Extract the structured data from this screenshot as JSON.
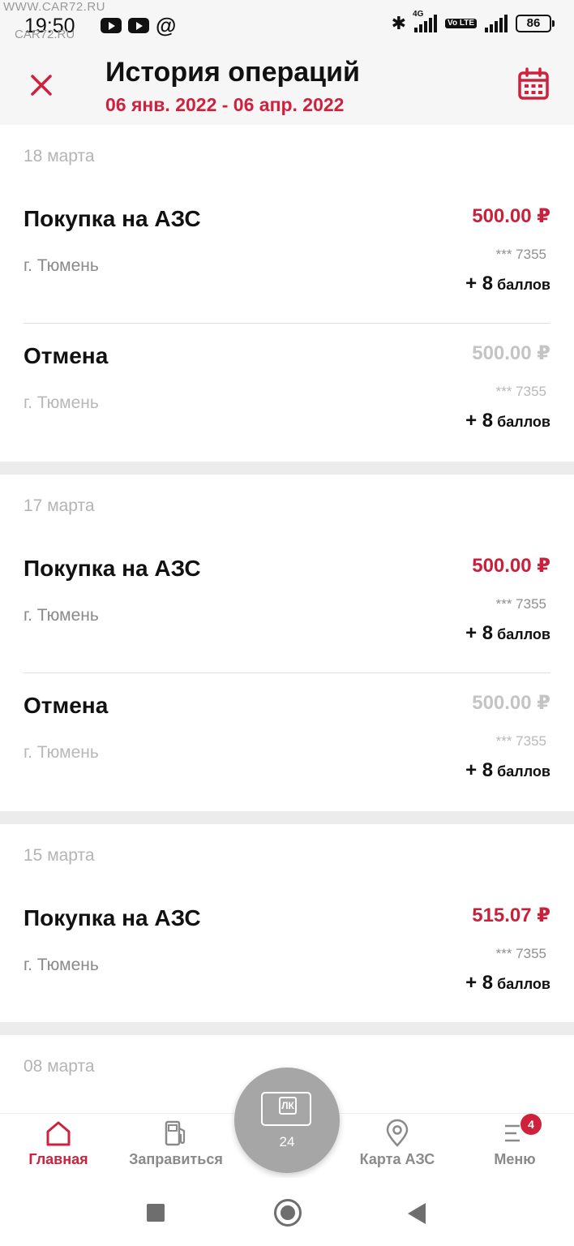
{
  "status_bar": {
    "time": "19:50",
    "watermark": "WWW.CAR72.RU",
    "watermark2": "CAR72.RU",
    "network_4g": "4G",
    "volte": "Vo LTE",
    "battery": "86"
  },
  "header": {
    "title": "История операций",
    "period": "06 янв. 2022 - 06 апр. 2022",
    "close_icon": "close-icon",
    "calendar_icon": "calendar-icon",
    "accent_color": "#d0213c"
  },
  "groups": [
    {
      "date": "18 марта",
      "operations": [
        {
          "title": "Покупка на АЗС",
          "city": "г. Тюмень",
          "amount": "500.00 ₽",
          "card": "*** 7355",
          "bonus_value": "+ 8",
          "bonus_unit": "баллов",
          "status": "purchase"
        },
        {
          "title": "Отмена",
          "city": "г. Тюмень",
          "amount": "500.00 ₽",
          "card": "*** 7355",
          "bonus_value": "+ 8",
          "bonus_unit": "баллов",
          "status": "cancel"
        }
      ]
    },
    {
      "date": "17 марта",
      "operations": [
        {
          "title": "Покупка на АЗС",
          "city": "г. Тюмень",
          "amount": "500.00 ₽",
          "card": "*** 7355",
          "bonus_value": "+ 8",
          "bonus_unit": "баллов",
          "status": "purchase"
        },
        {
          "title": "Отмена",
          "city": "г. Тюмень",
          "amount": "500.00 ₽",
          "card": "*** 7355",
          "bonus_value": "+ 8",
          "bonus_unit": "баллов",
          "status": "cancel"
        }
      ]
    },
    {
      "date": "15 марта",
      "operations": [
        {
          "title": "Покупка на АЗС",
          "city": "г. Тюмень",
          "amount": "515.07 ₽",
          "card": "*** 7355",
          "bonus_value": "+ 8",
          "bonus_unit": "баллов",
          "status": "purchase"
        }
      ]
    },
    {
      "date": "08 марта",
      "operations": []
    }
  ],
  "bottom_nav": {
    "items": [
      {
        "label": "Главная",
        "icon": "home-icon",
        "active": true
      },
      {
        "label": "Заправиться",
        "icon": "fuel-pump-icon",
        "active": false
      },
      {
        "label": "Карта АЗС",
        "icon": "map-pin-icon",
        "active": false
      },
      {
        "label": "Меню",
        "icon": "menu-icon",
        "active": false,
        "badge": "4"
      }
    ],
    "fab": {
      "logo_text": "ЛК",
      "count": "24",
      "icon": "loyalty-card-icon"
    }
  },
  "system_nav": {
    "recents": "recents-icon",
    "home": "home-circle-icon",
    "back": "back-icon"
  }
}
